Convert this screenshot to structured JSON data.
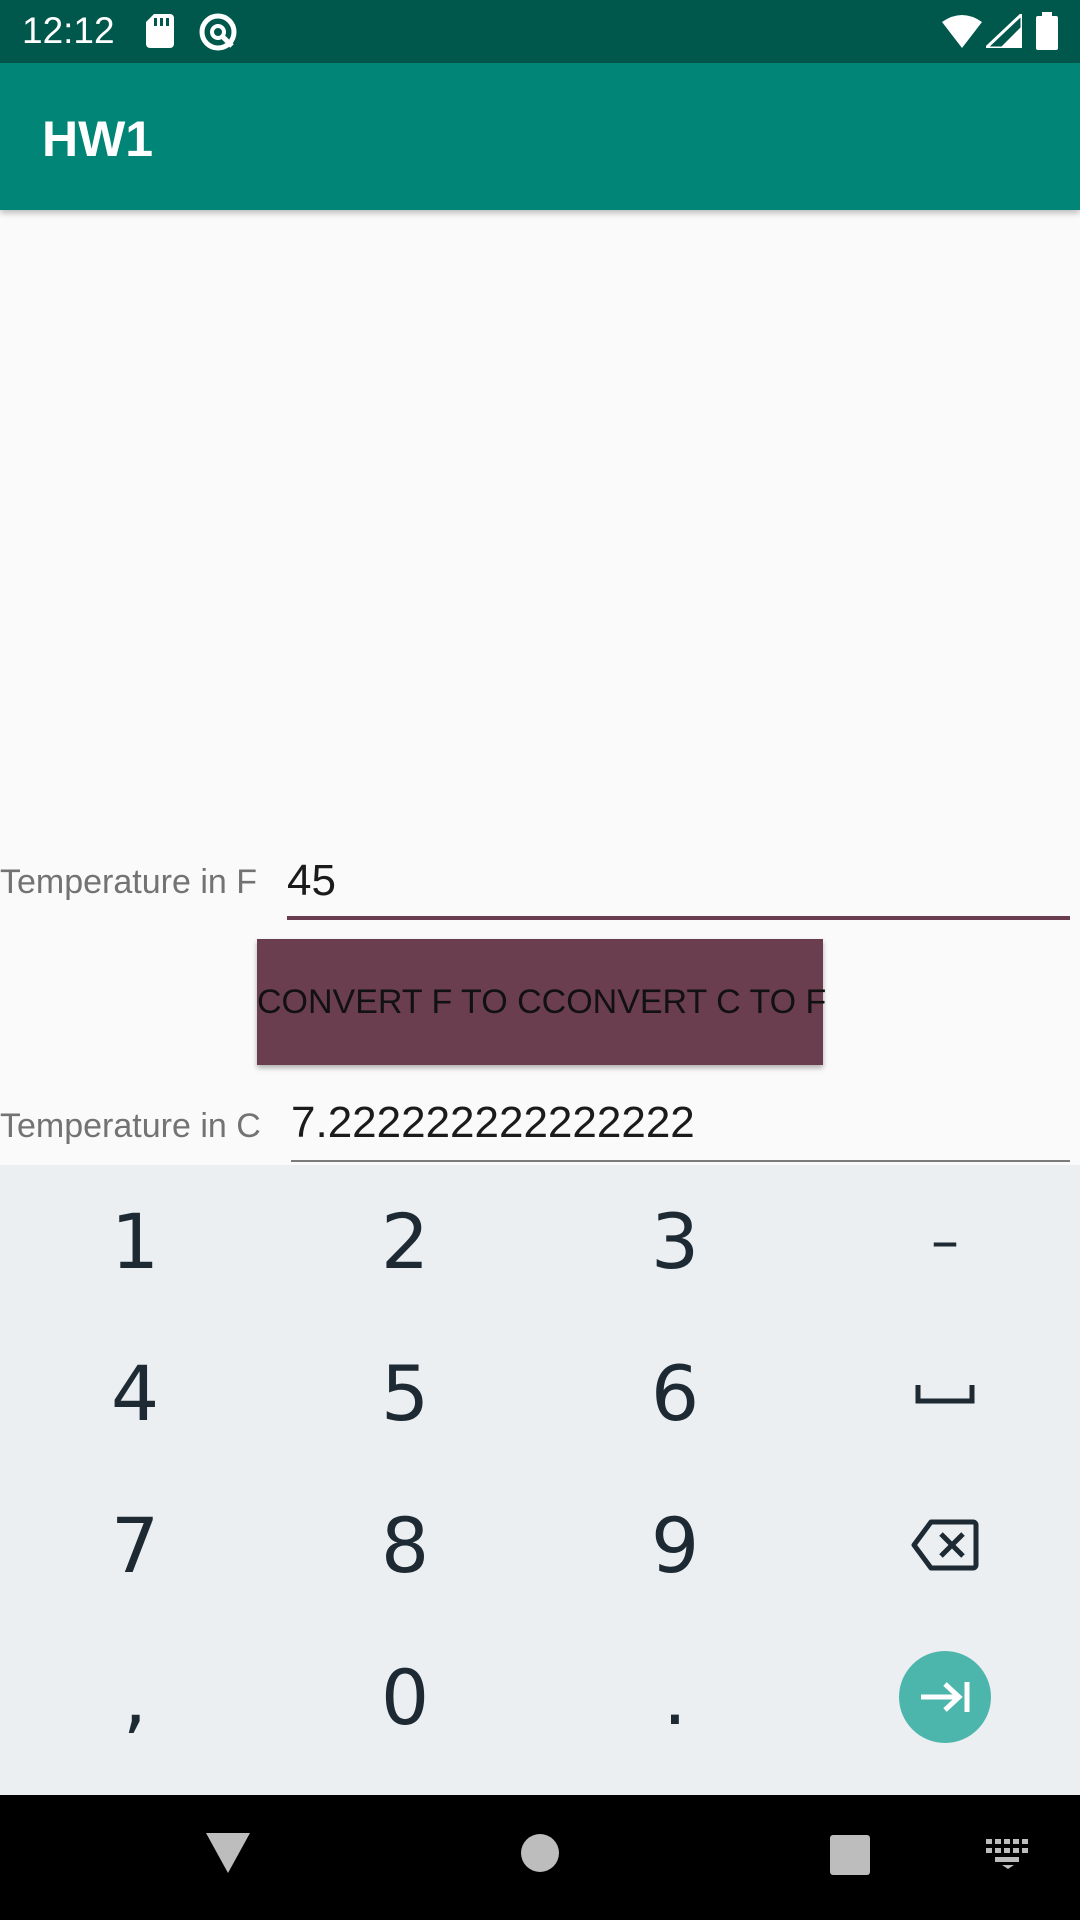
{
  "status_bar": {
    "time": "12:12",
    "icons": [
      "sd-card-icon",
      "assistant-icon",
      "wifi-icon",
      "signal-icon",
      "battery-icon"
    ]
  },
  "app_bar": {
    "title": "HW1",
    "color": "#008577"
  },
  "form": {
    "fahrenheit_label": "Temperature in F",
    "fahrenheit_value": "45",
    "convert_button_label": "CONVERT F TO CCONVERT C TO F",
    "celsius_label": "Temperature in C",
    "celsius_value": "7.222222222222222"
  },
  "keyboard": {
    "rows": [
      [
        "1",
        "2",
        "3",
        "–"
      ],
      [
        "4",
        "5",
        "6",
        "space-icon"
      ],
      [
        "7",
        "8",
        "9",
        "backspace-icon"
      ],
      [
        ",",
        "0",
        ".",
        "tab-next-icon"
      ]
    ],
    "keys": {
      "k1": "1",
      "k2": "2",
      "k3": "3",
      "minus": "–",
      "k4": "4",
      "k5": "5",
      "k6": "6",
      "k7": "7",
      "k8": "8",
      "k9": "9",
      "comma": ",",
      "k0": "0",
      "period": "."
    },
    "accent_color": "#4db6ac"
  },
  "nav_bar": {
    "icons": [
      "back-icon",
      "home-icon",
      "recents-icon",
      "keyboard-switch-icon"
    ]
  }
}
